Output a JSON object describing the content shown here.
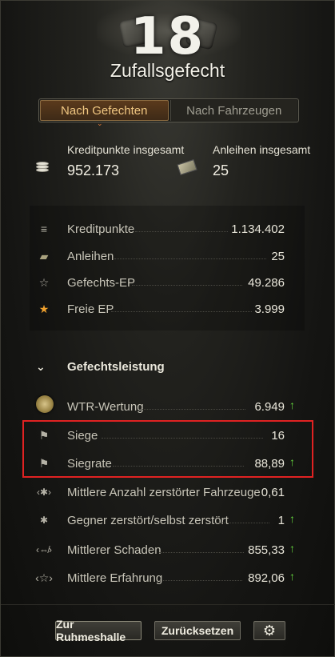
{
  "header": {
    "battle_count": "18",
    "mode_title": "Zufallsgefecht"
  },
  "tabs": [
    {
      "label": "Nach Gefechten",
      "active": true
    },
    {
      "label": "Nach Fahrzeugen",
      "active": false
    }
  ],
  "totals": {
    "credits_label": "Kreditpunkte insgesamt",
    "credits_value": "952.173",
    "credits_icon": "credits-icon",
    "bonds_label": "Anleihen insgesamt",
    "bonds_value": "25",
    "bonds_icon": "bonds-icon"
  },
  "earnings": [
    {
      "icon": "credits-icon",
      "label": "Kreditpunkte",
      "value": "1.134.402"
    },
    {
      "icon": "bonds-icon",
      "label": "Anleihen",
      "value": "25"
    },
    {
      "icon": "star-outline-icon",
      "label": "Gefechts-EP",
      "value": "49.286"
    },
    {
      "icon": "star-gold-icon",
      "label": "Freie EP",
      "value": "3.999"
    }
  ],
  "performance": {
    "section_title": "Gefechtsleistung",
    "rows": [
      {
        "icon": "wtr-emblem-icon",
        "label": "WTR-Wertung",
        "value": "6.949",
        "trend_up": true
      },
      {
        "icon": "flag-icon",
        "label": "Siege",
        "value": "16",
        "trend_up": false
      },
      {
        "icon": "flag-icon",
        "label": "Siegrate",
        "value": "88,89",
        "trend_up": true
      },
      {
        "icon": "tank-destroyed-icon",
        "label": "Mittlere Anzahl zerstörter Fahrzeuge",
        "value": "0,61",
        "trend_up": false
      },
      {
        "icon": "tank-ratio-icon",
        "label": "Gegner zerstört/selbst zerstört",
        "value": "1",
        "trend_up": true
      },
      {
        "icon": "damage-icon",
        "label": "Mittlerer Schaden",
        "value": "855,33",
        "trend_up": true
      },
      {
        "icon": "star-outline-icon",
        "label": "Mittlere Erfahrung",
        "value": "892,06",
        "trend_up": true
      }
    ]
  },
  "buttons": {
    "hall_of_fame": "Zur Ruhmeshalle",
    "reset": "Zurücksetzen",
    "settings_icon": "gear-icon"
  },
  "colors": {
    "accent_tab": "#f0c782",
    "trend_up": "#63d23d",
    "highlight_border": "#e02222"
  }
}
